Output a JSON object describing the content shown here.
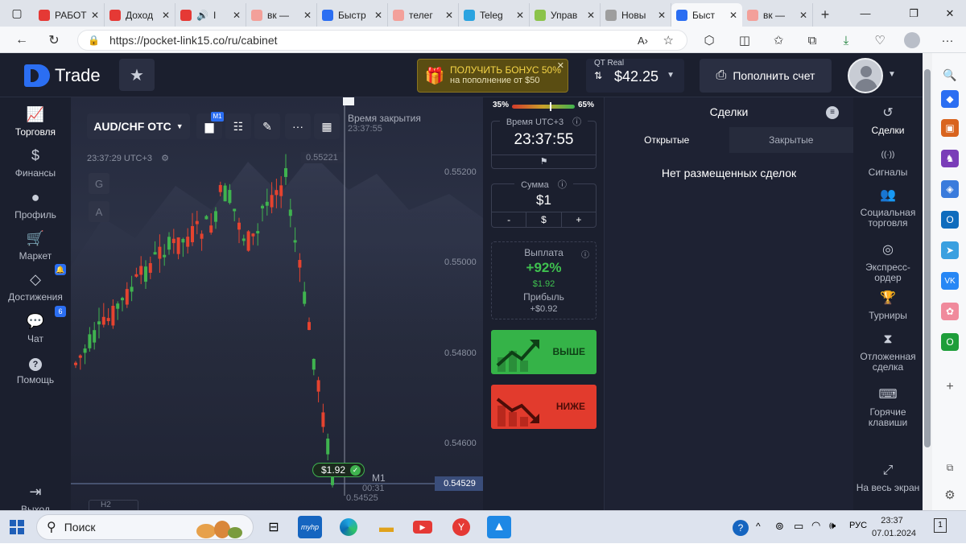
{
  "browser": {
    "tabs": [
      {
        "title": "РАБОТ",
        "favicon_color": "#e53935",
        "favicon": "youtube-icon"
      },
      {
        "title": "Доход",
        "favicon_color": "#e53935",
        "favicon": "youtube-icon"
      },
      {
        "title": "I",
        "favicon_color": "#e53935",
        "favicon": "youtube-icon",
        "audio": "🔊"
      },
      {
        "title": "вк —",
        "favicon_color": "#f3a09a",
        "favicon": "yandex-icon"
      },
      {
        "title": "Быстр",
        "favicon_color": "#2b6ef2",
        "favicon": "pocket-option-icon"
      },
      {
        "title": "телег",
        "favicon_color": "#f3a09a",
        "favicon": "yandex-icon"
      },
      {
        "title": "Teleg",
        "favicon_color": "#2aa3e0",
        "favicon": "telegram-icon"
      },
      {
        "title": "Управ",
        "favicon_color": "#8bc34a",
        "favicon": "number-3-icon"
      },
      {
        "title": "Новы",
        "favicon_color": "#9e9e9e",
        "favicon": "page-icon"
      },
      {
        "title": "Быст",
        "favicon_color": "#2b6ef2",
        "favicon": "pocket-option-icon",
        "active": true
      },
      {
        "title": "вк —",
        "favicon_color": "#f3a09a",
        "favicon": "yandex-icon"
      }
    ],
    "tab_close": "✕",
    "url": "https://pocket-link15.co/ru/cabinet"
  },
  "app": {
    "logo_text": "Trade",
    "bonus": {
      "line1": "ПОЛУЧИТЬ БОНУС 50%",
      "line2": "на пополнение от $50",
      "close": "✕"
    },
    "account": {
      "label": "QT Real",
      "balance": "$42.25"
    },
    "deposit_label": "Пополнить счет",
    "left_nav": [
      {
        "label": "Торговля",
        "icon": "chart-line-icon"
      },
      {
        "label": "Финансы",
        "icon": "dollar-icon"
      },
      {
        "label": "Профиль",
        "icon": "user-icon"
      },
      {
        "label": "Маркет",
        "icon": "cart-icon"
      },
      {
        "label": "Достижения",
        "icon": "diamond-icon",
        "badge": "🔔"
      },
      {
        "label": "Чат",
        "icon": "chat-icon",
        "badge": "6"
      },
      {
        "label": "Помощь",
        "icon": "help-icon"
      },
      {
        "label": "Выход",
        "icon": "logout-icon"
      }
    ],
    "chart": {
      "pair": "AUD/CHF OTC",
      "timeframe_badge": "M1",
      "clock": "23:37:29",
      "timezone": "UTC+3",
      "ga_buttons": [
        "G",
        "A"
      ],
      "close_time_label": "Время закрытия",
      "close_time": "23:37:55",
      "top_price": "0.55221",
      "price_labels": [
        "0.55200",
        "0.55000",
        "0.54800",
        "0.54600"
      ],
      "current_price": "0.54529",
      "bottom_price": "0.54525",
      "trade_amount": "$1.92",
      "candle_label": "M1",
      "timer": "00:31",
      "timeframe_select": "H2"
    },
    "trade_panel": {
      "sell_pct": "35%",
      "buy_pct": "65%",
      "sentiment_buy_fraction": 0.65,
      "time_label": "Время UTC+3",
      "time_value": "23:37:55",
      "sum_label": "Сумма",
      "sum_value": "$1",
      "sum_minus": "-",
      "sum_currency": "$",
      "sum_plus": "+",
      "payout_label": "Выплата",
      "payout_pct": "+92%",
      "payout_amount": "$1.92",
      "profit_label": "Прибыль",
      "profit_value": "+$0.92",
      "up_label": "ВЫШЕ",
      "down_label": "НИЖЕ"
    },
    "deals": {
      "title": "Сделки",
      "tab_open": "Открытые",
      "tab_closed": "Закрытые",
      "empty": "Нет размещенных сделок"
    },
    "right_nav": [
      {
        "label": "Сделки",
        "icon": "history-icon"
      },
      {
        "label": "Сигналы",
        "icon": "signal-icon"
      },
      {
        "label": "Социальная торговля",
        "icon": "social-icon"
      },
      {
        "label": "Экспресс-ордер",
        "icon": "target-icon"
      },
      {
        "label": "Турниры",
        "icon": "trophy-icon"
      },
      {
        "label": "Отложенная сделка",
        "icon": "hourglass-icon"
      },
      {
        "label": "Горячие клавиши",
        "icon": "keyboard-icon"
      },
      {
        "label": "На весь экран",
        "icon": "fullscreen-icon"
      }
    ]
  },
  "taskbar": {
    "search_placeholder": "Поиск",
    "language": "РУС",
    "time": "23:37",
    "date": "07.01.2024",
    "notifications": "1"
  }
}
